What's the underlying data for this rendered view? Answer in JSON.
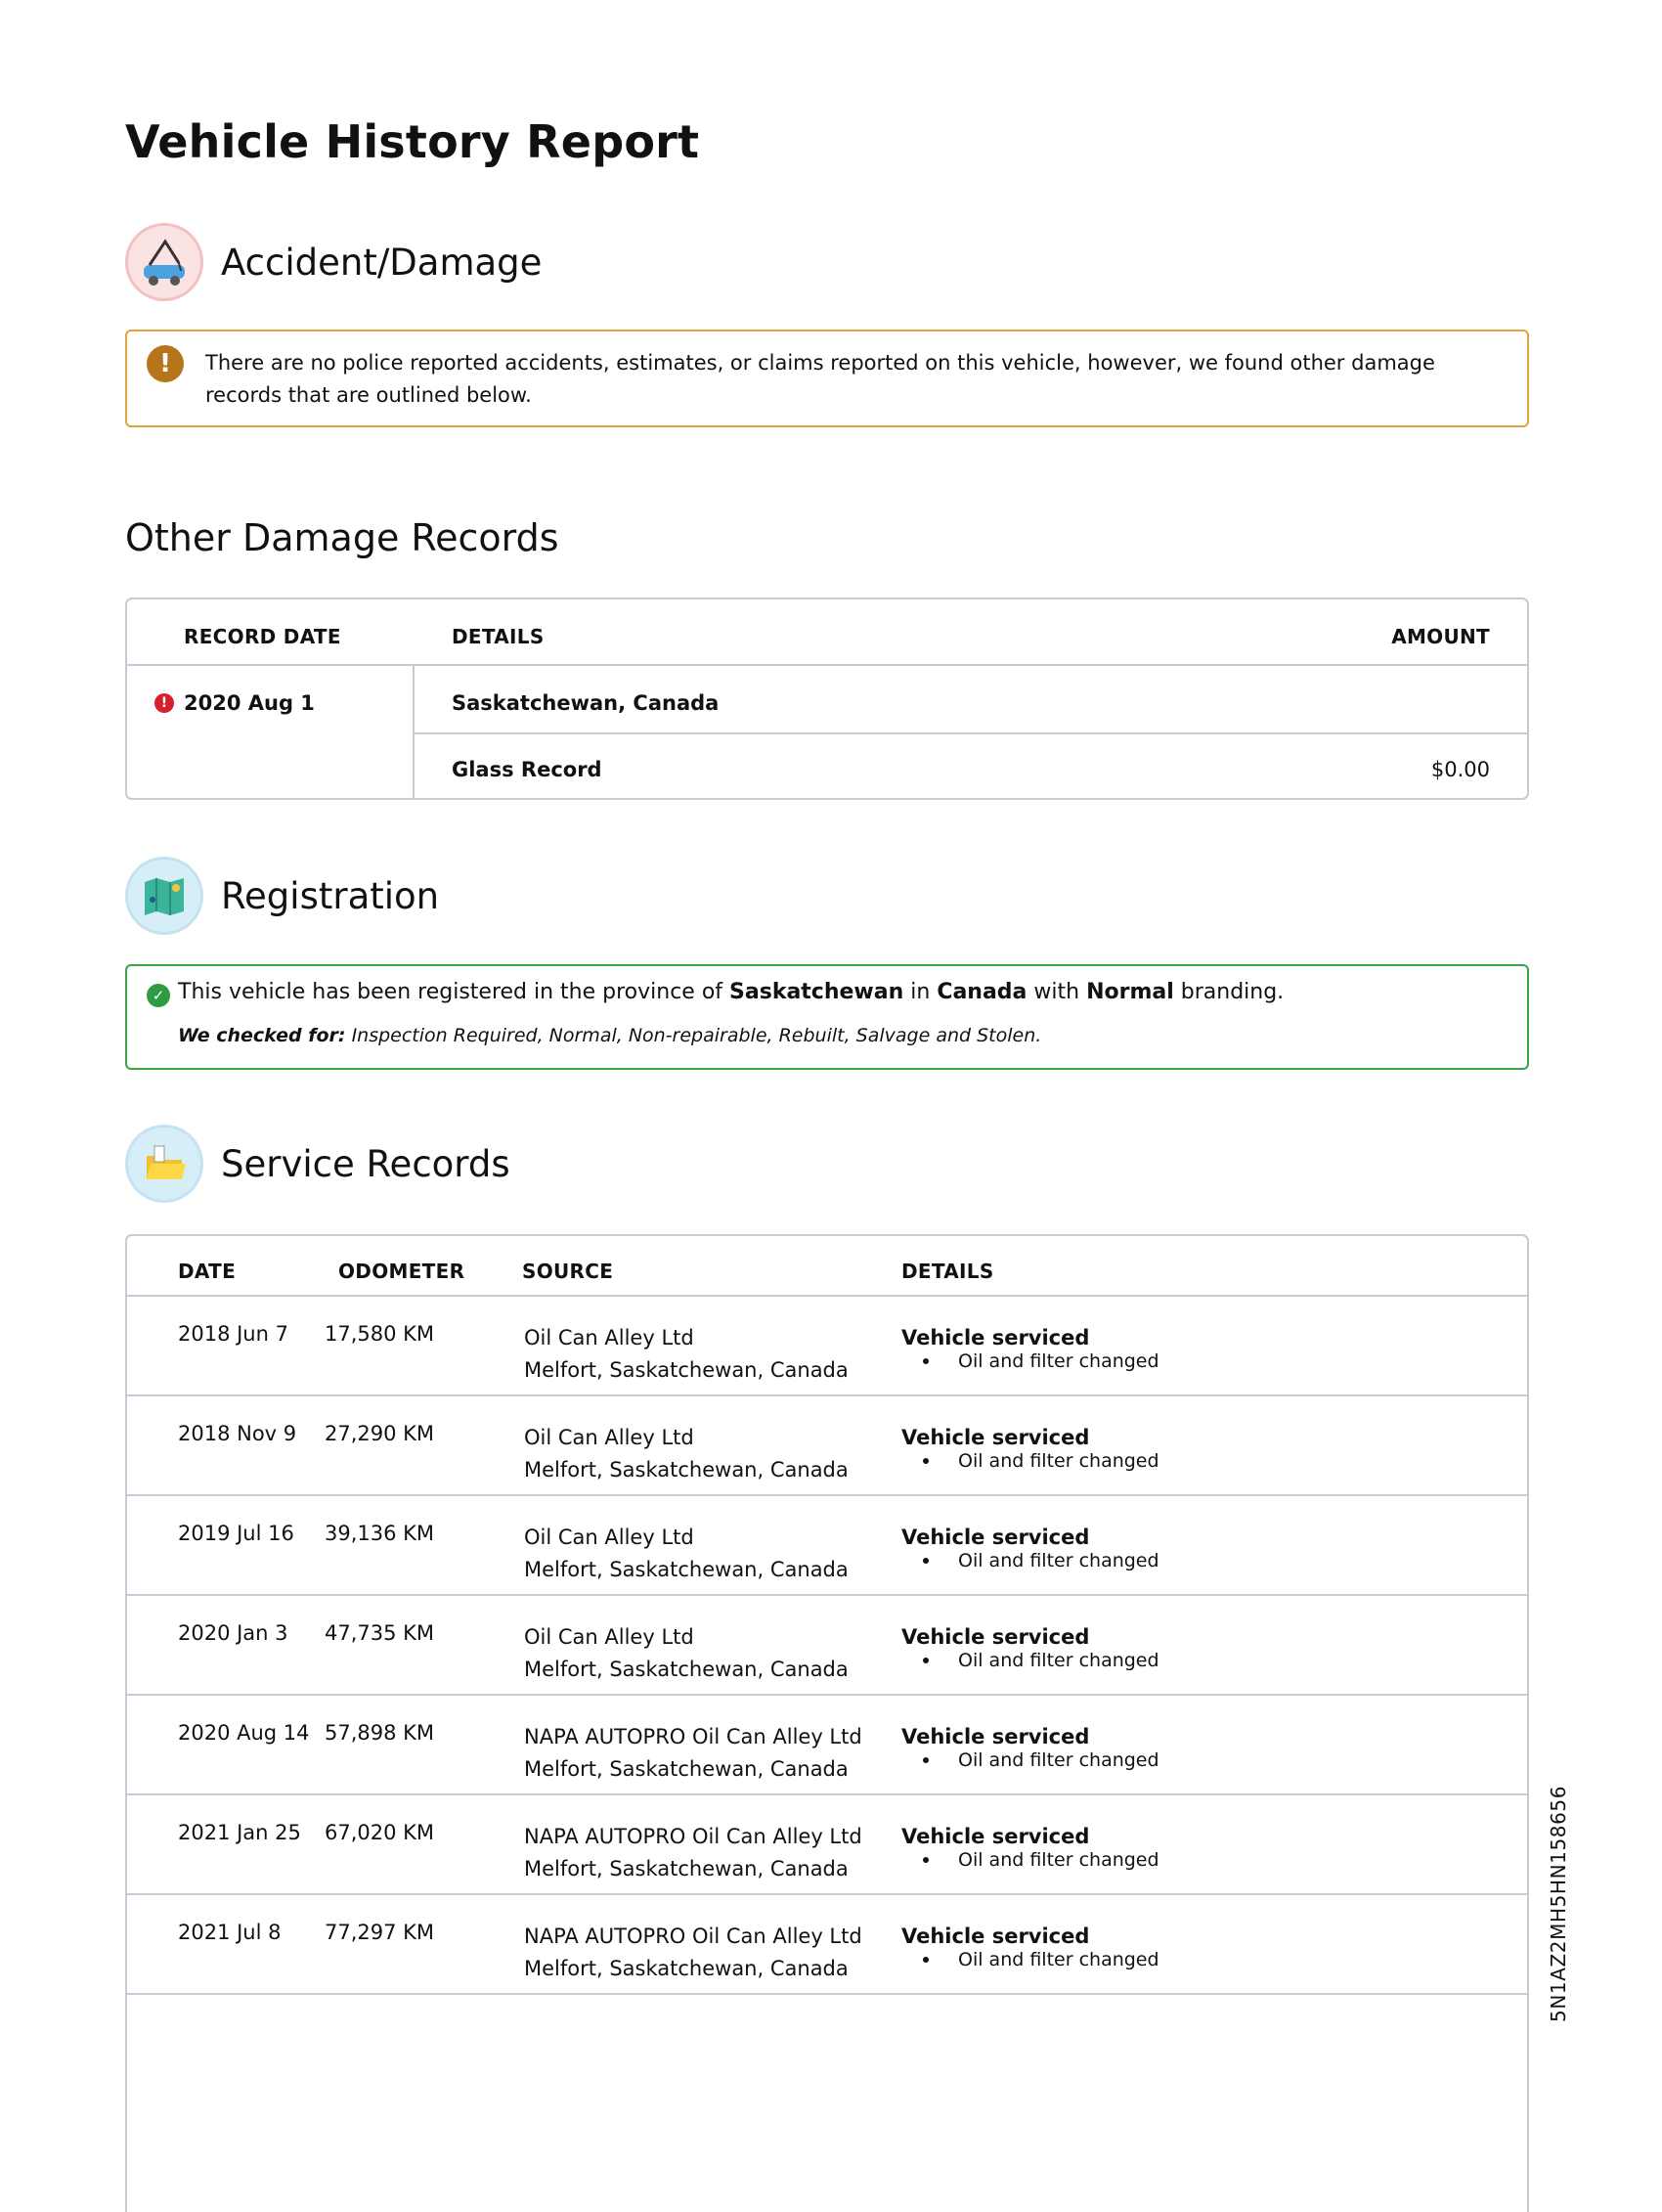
{
  "title": "Vehicle History Report",
  "accident": {
    "title": "Accident/Damage",
    "alert_text": "There are no police reported accidents, estimates, or claims reported on this vehicle, however, we found other damage records that are outlined below."
  },
  "other_damage": {
    "title": "Other Damage Records",
    "headers": {
      "date": "RECORD DATE",
      "details": "DETAILS",
      "amount": "AMOUNT"
    },
    "record": {
      "date": "2020 Aug 1",
      "location": "Saskatchewan, Canada",
      "type": "Glass Record",
      "amount": "$0.00"
    }
  },
  "registration": {
    "title": "Registration",
    "line_prefix": "This vehicle has been registered in the province of ",
    "province": "Saskatchewan",
    "line_mid": " in ",
    "country": "Canada",
    "line_mid2": " with ",
    "branding": "Normal",
    "line_suffix": " branding.",
    "checked_label": "We checked for:",
    "checked_list": " Inspection Required, Normal, Non-repairable, Rebuilt, Salvage and Stolen."
  },
  "service": {
    "title": "Service Records",
    "headers": {
      "date": "DATE",
      "odometer": "ODOMETER",
      "source": "SOURCE",
      "details": "DETAILS"
    },
    "rows": [
      {
        "date": "2018 Jun 7",
        "odometer": "17,580 KM",
        "source": "Oil Can Alley Ltd",
        "location": "Melfort, Saskatchewan, Canada",
        "detail": "Vehicle serviced",
        "item": "Oil and filter changed"
      },
      {
        "date": "2018 Nov 9",
        "odometer": "27,290 KM",
        "source": "Oil Can Alley Ltd",
        "location": "Melfort, Saskatchewan, Canada",
        "detail": "Vehicle serviced",
        "item": "Oil and filter changed"
      },
      {
        "date": "2019 Jul 16",
        "odometer": "39,136 KM",
        "source": "Oil Can Alley Ltd",
        "location": "Melfort, Saskatchewan, Canada",
        "detail": "Vehicle serviced",
        "item": "Oil and filter changed"
      },
      {
        "date": "2020 Jan 3",
        "odometer": "47,735 KM",
        "source": "Oil Can Alley Ltd",
        "location": "Melfort, Saskatchewan, Canada",
        "detail": "Vehicle serviced",
        "item": "Oil and filter changed"
      },
      {
        "date": "2020 Aug 14",
        "odometer": "57,898 KM",
        "source": "NAPA AUTOPRO Oil Can Alley Ltd",
        "location": "Melfort, Saskatchewan, Canada",
        "detail": "Vehicle serviced",
        "item": "Oil and filter changed"
      },
      {
        "date": "2021 Jan 25",
        "odometer": "67,020 KM",
        "source": "NAPA AUTOPRO Oil Can Alley Ltd",
        "location": "Melfort, Saskatchewan, Canada",
        "detail": "Vehicle serviced",
        "item": "Oil and filter changed"
      },
      {
        "date": "2021 Jul 8",
        "odometer": "77,297 KM",
        "source": "NAPA AUTOPRO Oil Can Alley Ltd",
        "location": "Melfort, Saskatchewan, Canada",
        "detail": "Vehicle serviced",
        "item": "Oil and filter changed"
      }
    ]
  },
  "vin": "5N1AZ2MH5HN158656"
}
